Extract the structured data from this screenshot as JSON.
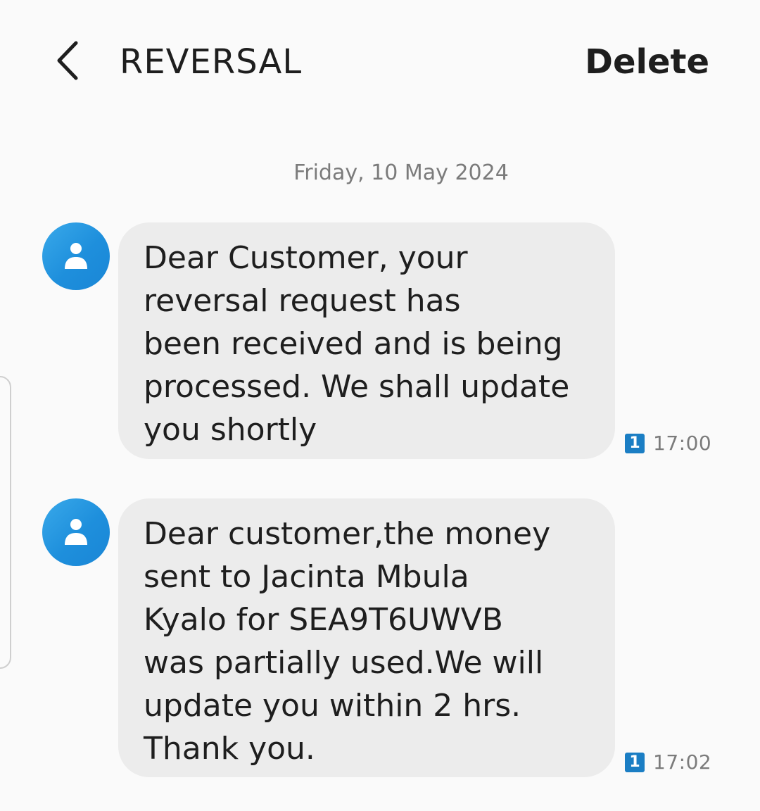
{
  "header": {
    "title": "REVERSAL",
    "delete_label": "Delete"
  },
  "conversation": {
    "date": "Friday, 10 May 2024",
    "messages": [
      {
        "text": "Dear Customer, your\nreversal request has\nbeen received and is being\nprocessed. We shall update\nyou shortly",
        "sim": "1",
        "time": "17:00"
      },
      {
        "text": "Dear customer,the money\nsent to  Jacinta Mbula\nKyalo for SEA9T6UWVB\nwas partially used.We will\nupdate you within 2 hrs.\nThank you.",
        "sim": "1",
        "time": "17:02"
      }
    ]
  },
  "icons": {
    "back": "chevron-left-icon",
    "avatar": "person-icon"
  },
  "colors": {
    "background": "#fafafa",
    "bubble": "#ececec",
    "avatar": "#1e8fdc",
    "sim_badge": "#1b7ec4",
    "muted_text": "#7b7b7b"
  }
}
